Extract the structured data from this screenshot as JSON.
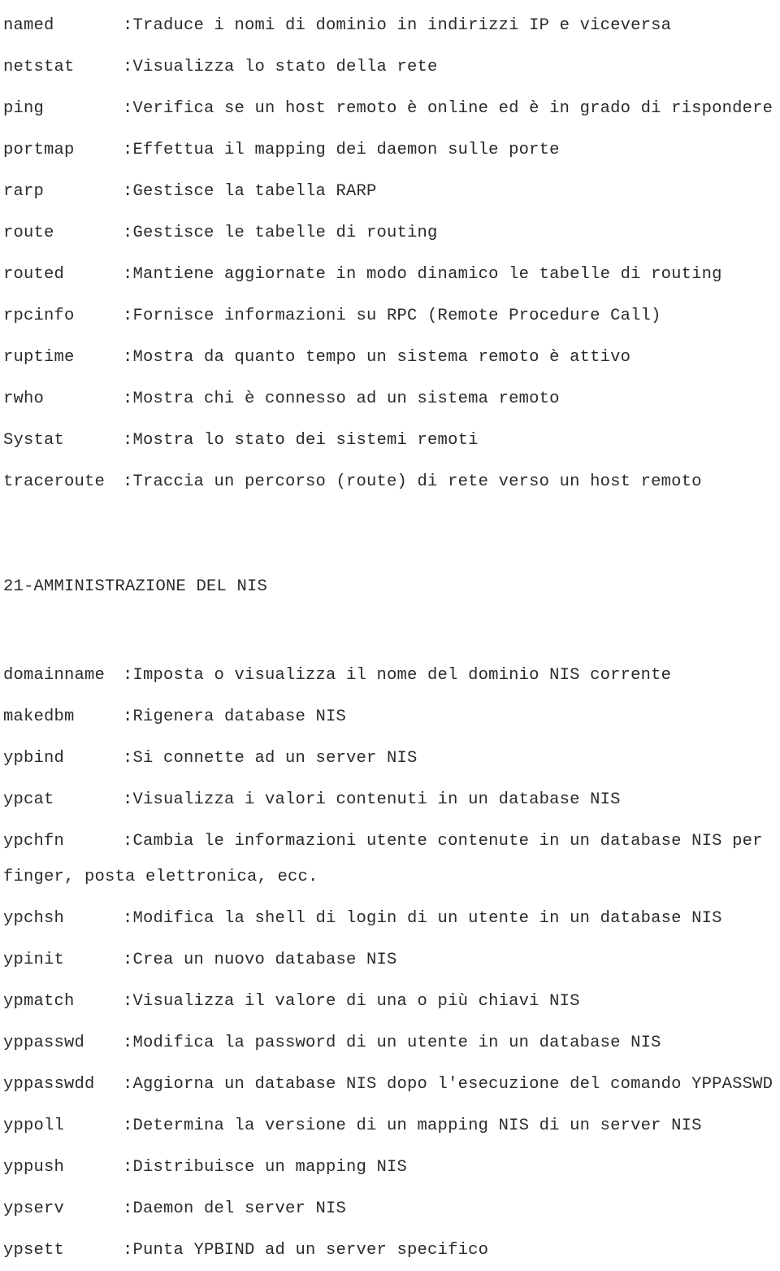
{
  "document": {
    "text_color": "#2b2b2b",
    "background_color": "#ffffff",
    "separator": ":"
  },
  "network_commands": {
    "entries": [
      {
        "command": "named",
        "description": ":Traduce i nomi di dominio in indirizzi IP e viceversa"
      },
      {
        "command": "netstat",
        "description": ":Visualizza lo stato della rete"
      },
      {
        "command": "ping",
        "description": ":Verifica se un host remoto è online ed è in grado di rispondere"
      },
      {
        "command": "portmap",
        "description": ":Effettua il mapping dei daemon sulle porte"
      },
      {
        "command": "rarp",
        "description": ":Gestisce la tabella RARP"
      },
      {
        "command": "route",
        "description": ":Gestisce le tabelle di routing"
      },
      {
        "command": "routed",
        "description": ":Mantiene aggiornate in modo dinamico le tabelle di routing"
      },
      {
        "command": "rpcinfo",
        "description": ":Fornisce informazioni su RPC (Remote Procedure Call)"
      },
      {
        "command": "ruptime",
        "description": ":Mostra da quanto tempo un sistema remoto è attivo"
      },
      {
        "command": "rwho",
        "description": ":Mostra chi è connesso ad un sistema remoto"
      },
      {
        "command": "Systat",
        "description": ":Mostra lo stato dei sistemi remoti"
      },
      {
        "command": "traceroute",
        "description": ":Traccia un percorso (route) di rete verso un host remoto"
      }
    ]
  },
  "nis_section": {
    "heading": "21-AMMINISTRAZIONE DEL NIS",
    "entries": [
      {
        "command": "domainname",
        "description": ":Imposta o visualizza il nome del dominio NIS corrente"
      },
      {
        "command": "makedbm",
        "description": ":Rigenera database NIS"
      },
      {
        "command": "ypbind",
        "description": ":Si connette ad un server NIS"
      },
      {
        "command": "ypcat",
        "description": ":Visualizza i valori contenuti in un database NIS"
      },
      {
        "command": "ypchfn",
        "description": ":Cambia le informazioni utente contenute in un database NIS per",
        "continuation": "finger, posta elettronica, ecc."
      },
      {
        "command": "ypchsh",
        "description": ":Modifica la shell di login di un utente in un database NIS"
      },
      {
        "command": "ypinit",
        "description": ":Crea un nuovo database NIS"
      },
      {
        "command": "ypmatch",
        "description": ":Visualizza il valore di una o più chiavi NIS"
      },
      {
        "command": "yppasswd",
        "description": ":Modifica la password di un utente in un database NIS"
      },
      {
        "command": "yppasswdd",
        "description": ":Aggiorna un database NIS dopo l'esecuzione del comando YPPASSWD"
      },
      {
        "command": "yppoll",
        "description": ":Determina la versione di un mapping NIS di un server NIS"
      },
      {
        "command": "yppush",
        "description": ":Distribuisce un mapping NIS"
      },
      {
        "command": "ypserv",
        "description": ":Daemon del server NIS"
      },
      {
        "command": "ypsett",
        "description": ":Punta YPBIND ad un server specifico"
      }
    ]
  }
}
